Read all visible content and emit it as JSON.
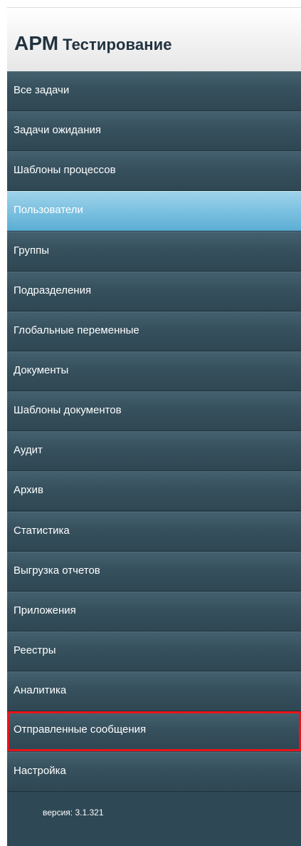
{
  "header": {
    "abbr": "АРМ",
    "title": "Тестирование"
  },
  "menu": {
    "items": [
      {
        "label": "Все задачи"
      },
      {
        "label": "Задачи ожидания"
      },
      {
        "label": "Шаблоны процессов"
      },
      {
        "label": "Пользователи",
        "state": "active"
      },
      {
        "label": "Группы"
      },
      {
        "label": "Подразделения"
      },
      {
        "label": "Глобальные переменные"
      },
      {
        "label": "Документы"
      },
      {
        "label": "Шаблоны документов"
      },
      {
        "label": "Аудит"
      },
      {
        "label": "Архив"
      },
      {
        "label": "Статистика"
      },
      {
        "label": "Выгрузка отчетов"
      },
      {
        "label": "Приложения"
      },
      {
        "label": "Реестры"
      },
      {
        "label": "Аналитика"
      },
      {
        "label": "Отправленные сообщения",
        "state": "highlighted-red-border"
      },
      {
        "label": "Настройка"
      }
    ]
  },
  "footer": {
    "version": "версия: 3.1.321"
  },
  "colors": {
    "menu_bg": "#2f4855",
    "active_bg": "#7cc1e0",
    "highlight_border": "#e8141b",
    "title_text": "#223340"
  }
}
